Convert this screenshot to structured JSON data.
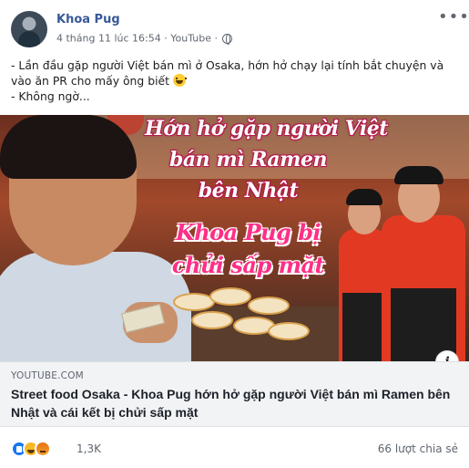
{
  "post": {
    "author": "Khoa Pug",
    "timestamp": "4 tháng 11 lúc 16:54",
    "separator": "·",
    "via": "YouTube",
    "icons": {
      "privacy": "globe-icon",
      "more": "more-options-icon"
    }
  },
  "message": {
    "line1": "- Lần đầu gặp người Việt bán mì ở Osaka, hớn hở chạy lại tính bắt chuyện và vào ăn PR cho mấy ông biết",
    "line2": "- Không ngờ..."
  },
  "thumbnail": {
    "line1": "Hớn hở gặp người Việt",
    "line2": "bán mì Ramen",
    "line3": "bên Nhật",
    "line4": "Khoa Pug bị",
    "line5": "chửi sấp mặt"
  },
  "link": {
    "domain": "YOUTUBE.COM",
    "title": "Street food Osaka - Khoa Pug hớn hở gặp người Việt bán mì Ramen bên Nhật và cái kết bị chửi sấp mặt",
    "info_label": "i"
  },
  "footer": {
    "reactions": [
      "like-icon",
      "haha-icon",
      "angry-icon"
    ],
    "reaction_count": "1,3K",
    "share_count": "66 lượt chia sẻ"
  },
  "colors": {
    "author_link": "#385898",
    "meta_text": "#606770",
    "overlay_pink": "#ff2f86",
    "link_bg": "#f2f3f5",
    "like_blue": "#1877f2"
  }
}
